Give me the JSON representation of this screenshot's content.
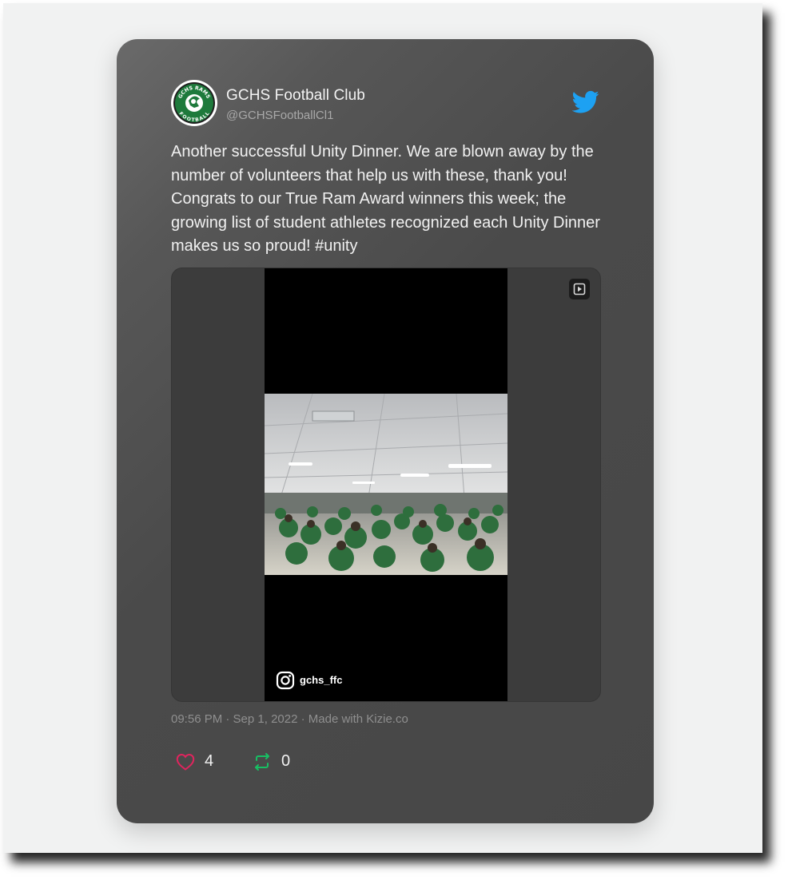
{
  "author": {
    "name": "GCHS Football Club",
    "handle": "@GCHSFootballCl1",
    "avatar_text_top": "GCHS RAMS",
    "avatar_text_bottom": "FOOTBALL"
  },
  "tweet": {
    "text": "Another successful Unity Dinner. We are blown away by the number of volunteers that help us with these, thank you! Congrats to our True Ram Award winners this week; the growing list of student athletes recognized each Unity Dinner makes us so proud! #unity"
  },
  "media": {
    "type": "video",
    "source_handle": "gchs_ffc"
  },
  "meta": {
    "timestamp": "09:56 PM · Sep 1, 2022 · Made with Kizie.co"
  },
  "actions": {
    "likes": "4",
    "retweets": "0"
  },
  "colors": {
    "card_bg": "#474747",
    "heart": "#e0245e",
    "retweet": "#17bf63",
    "twitter_blue": "#1da1f2",
    "brand_green": "#1e7a3c"
  },
  "icons": [
    "twitter-icon",
    "video-play-icon",
    "instagram-icon",
    "heart-icon",
    "retweet-icon"
  ]
}
